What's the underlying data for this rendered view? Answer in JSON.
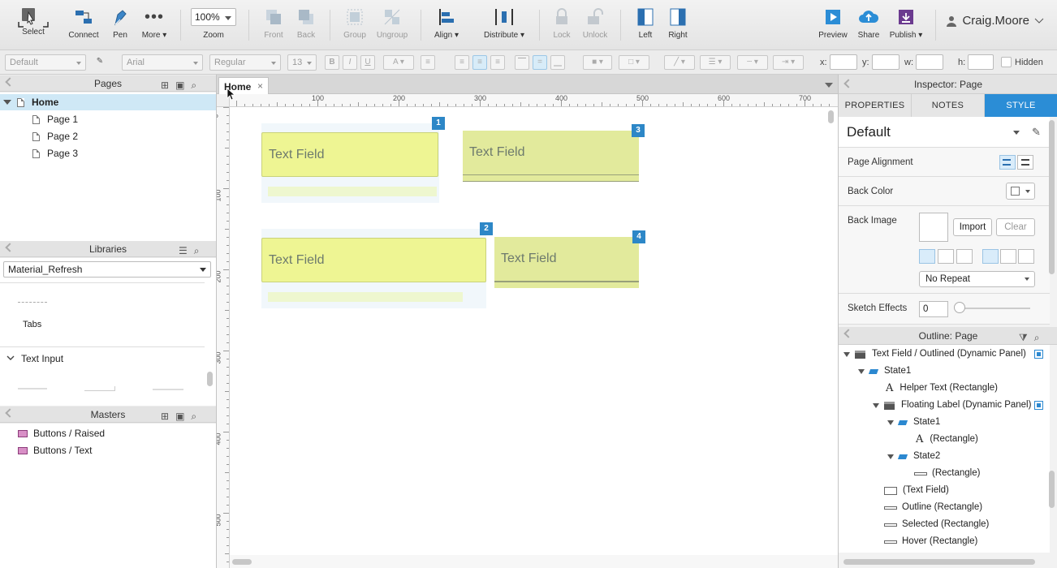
{
  "toolbar": {
    "select": "Select",
    "connect": "Connect",
    "pen": "Pen",
    "more": "More ▾",
    "zoom_value": "100%",
    "zoom": "Zoom",
    "front": "Front",
    "back": "Back",
    "group": "Group",
    "ungroup": "Ungroup",
    "align": "Align ▾",
    "distribute": "Distribute ▾",
    "lock": "Lock",
    "unlock": "Unlock",
    "left": "Left",
    "right": "Right",
    "preview": "Preview",
    "share": "Share",
    "publish": "Publish ▾",
    "user": "Craig.Moore"
  },
  "formatbar": {
    "style": "Default",
    "font": "Arial",
    "weight": "Regular",
    "size": "13",
    "x_label": "x:",
    "y_label": "y:",
    "w_label": "w:",
    "h_label": "h:",
    "hidden_label": "Hidden"
  },
  "pages": {
    "title": "Pages",
    "items": [
      "Home",
      "Page 1",
      "Page 2",
      "Page 3"
    ]
  },
  "libraries": {
    "title": "Libraries",
    "selected": "Material_Refresh",
    "tabs_label": "Tabs",
    "group_label": "Text Input"
  },
  "masters": {
    "title": "Masters",
    "items": [
      "Buttons / Raised",
      "Buttons / Text"
    ]
  },
  "canvas": {
    "tab": "Home",
    "close": "×",
    "ruler_h": [
      "100",
      "200",
      "300",
      "400",
      "500",
      "600",
      "700"
    ],
    "ruler_v": [
      "0",
      "100",
      "200",
      "300",
      "400",
      "500"
    ],
    "fields": [
      {
        "badge": "1",
        "label": "Text Field"
      },
      {
        "badge": "2",
        "label": "Text Field"
      },
      {
        "badge": "3",
        "label": "Text Field"
      },
      {
        "badge": "4",
        "label": "Text Field"
      }
    ],
    "colors": {
      "field_fill": "#eef593",
      "field_fill_muted": "#e2ea9c",
      "badge": "#2d87c7"
    }
  },
  "inspector": {
    "title": "Inspector: Page",
    "tabs": [
      "PROPERTIES",
      "NOTES",
      "STYLE"
    ],
    "style_name": "Default",
    "page_alignment": "Page Alignment",
    "back_color": "Back Color",
    "back_image": "Back Image",
    "import": "Import",
    "clear": "Clear",
    "repeat": "No Repeat",
    "sketch_effects": "Sketch Effects",
    "sketch_value": "0",
    "accent": "#2b8dd6"
  },
  "outline": {
    "title": "Outline: Page",
    "rows": [
      "Text Field / Outlined (Dynamic Panel)",
      "State1",
      "Helper Text (Rectangle)",
      "Floating Label (Dynamic Panel)",
      "State1",
      "(Rectangle)",
      "State2",
      "(Rectangle)",
      "(Text Field)",
      "Outline (Rectangle)",
      "Selected (Rectangle)",
      "Hover (Rectangle)"
    ]
  }
}
